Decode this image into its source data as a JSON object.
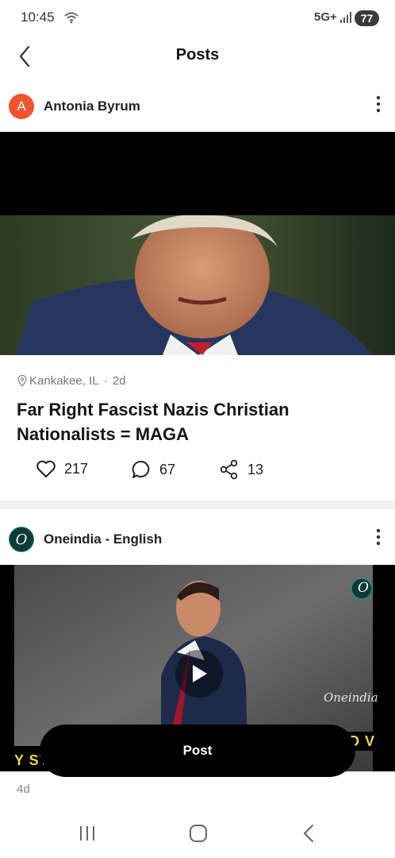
{
  "status_bar": {
    "time": "10:45",
    "network": "5G+",
    "battery": "77"
  },
  "header": {
    "title": "Posts",
    "back_icon": "chevron-left-icon"
  },
  "posts": [
    {
      "avatar_letter": "A",
      "avatar_color": "#f0532d",
      "author": "Antonia Byrum",
      "location": "Kankakee, IL",
      "separator": " · ",
      "age": "2d",
      "title": "Far Right Fascist Nazis Christian Nationalists = MAGA",
      "likes": "217",
      "comments": "67",
      "shares": "13"
    },
    {
      "author": "Oneindia - English",
      "avatar_letter": "O",
      "avatar_color": "#0d3b3a",
      "video_watermark": "Oneindia",
      "ticker_left": "Y ST",
      "ticker_right": "D V",
      "age": "4d"
    }
  ],
  "post_button": {
    "label": "Post"
  },
  "colors": {
    "accent_orange": "#f0532d",
    "brand_teal": "#0d3b3a",
    "ticker_yellow": "#e8d84a"
  }
}
